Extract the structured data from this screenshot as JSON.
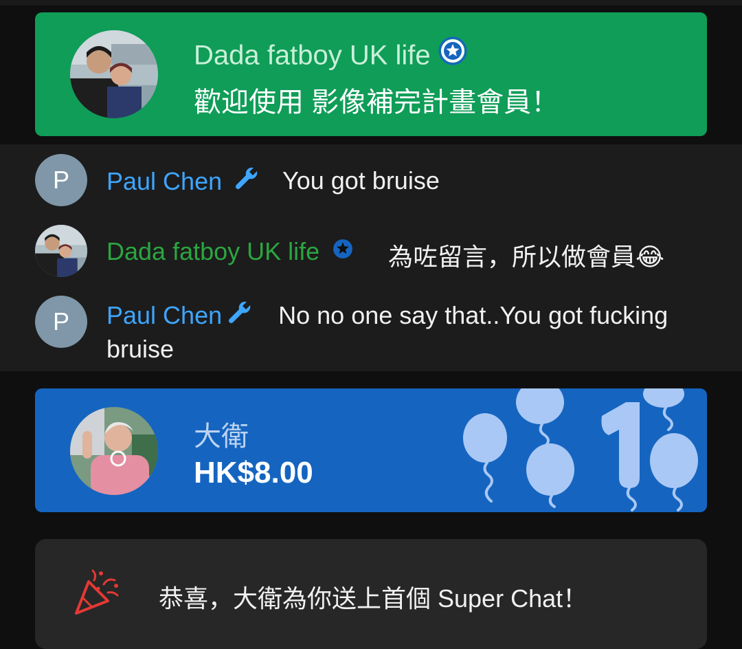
{
  "membership": {
    "author": "Dada fatboy UK life",
    "message": "歡迎使用 影像補完計畫會員！",
    "badge_icon": "verified-star-icon",
    "color": "#0f9d58"
  },
  "chat": [
    {
      "avatar_letter": "P",
      "author": "Paul Chen",
      "badge_icon": "wrench-icon",
      "text": "You got bruise"
    },
    {
      "author": "Dada fatboy UK life",
      "badge_icon": "member-star-icon",
      "text": "為咗留言，所以做會員😂"
    },
    {
      "avatar_letter": "P",
      "author": "Paul Chen",
      "badge_icon": "wrench-icon",
      "text": "No no one say that..You got fucking bruise"
    }
  ],
  "superchat": {
    "name": "大衛",
    "amount": "HK$8.00",
    "color": "#1565c0"
  },
  "congrats": {
    "icon": "party-popper-icon",
    "text": "恭喜，大衛為你送上首個 Super Chat！"
  }
}
